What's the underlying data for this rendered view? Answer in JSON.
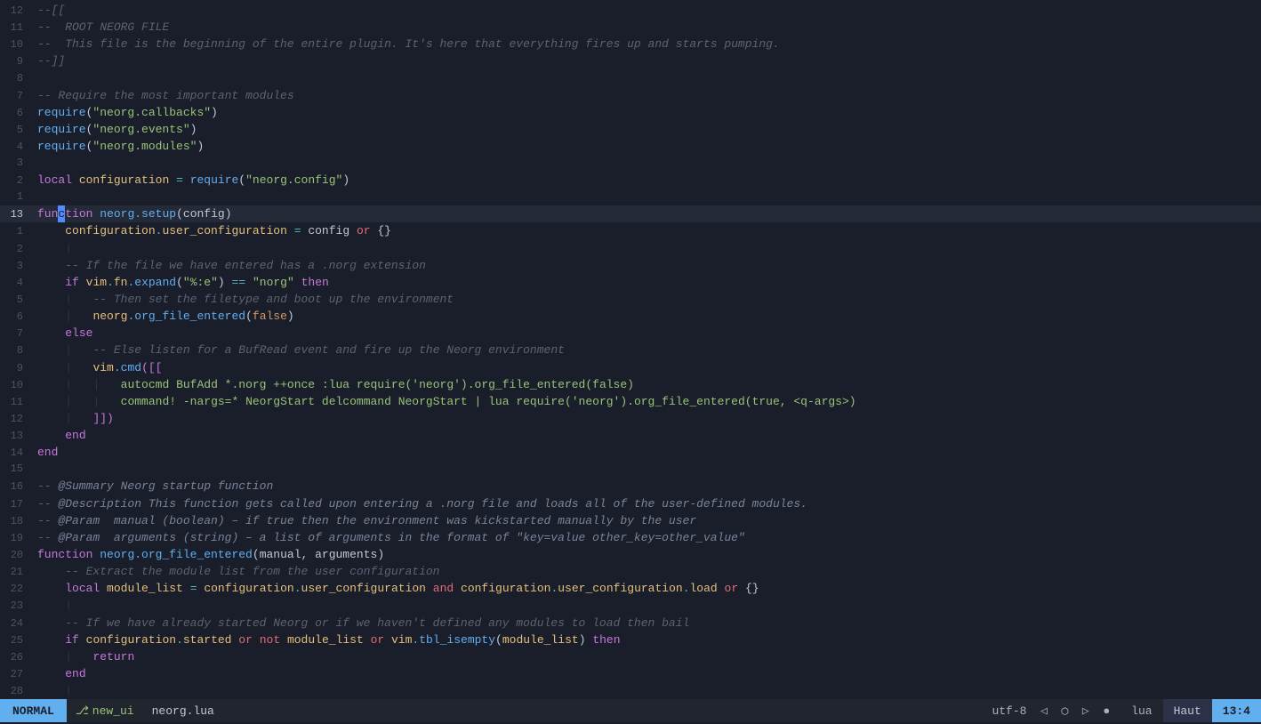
{
  "editor": {
    "lines": [
      {
        "num": "12",
        "content": "--[[",
        "reversed": false
      },
      {
        "num": "11",
        "content": "--  ROOT NEORG FILE",
        "reversed": false
      },
      {
        "num": "10",
        "content": "--  This file is the beginning of the entire plugin. It's here that everything fires up and starts pumping.",
        "reversed": false
      },
      {
        "num": "9",
        "content": "--]]",
        "reversed": false
      },
      {
        "num": "8",
        "content": "",
        "reversed": false
      },
      {
        "num": "7",
        "content": "-- Require the most important modules",
        "reversed": false
      },
      {
        "num": "6",
        "content": "require(\"neorg.callbacks\")",
        "reversed": false
      },
      {
        "num": "5",
        "content": "require(\"neorg.events\")",
        "reversed": false
      },
      {
        "num": "4",
        "content": "require(\"neorg.modules\")",
        "reversed": false
      },
      {
        "num": "3",
        "content": "",
        "reversed": false
      },
      {
        "num": "2",
        "content": "local configuration = require(\"neorg.config\")",
        "reversed": false
      },
      {
        "num": "1",
        "content": "",
        "reversed": false
      },
      {
        "num": "13",
        "content": "function neorg.setup(config)",
        "current": true,
        "reversed": false
      },
      {
        "num": "1",
        "content": "    configuration.user_configuration = config or {}",
        "reversed": false
      },
      {
        "num": "2",
        "content": "    |",
        "reversed": false
      },
      {
        "num": "3",
        "content": "    -- If the file we have entered has a .norg extension",
        "reversed": false
      },
      {
        "num": "4",
        "content": "    if vim.fn.expand(\"%:e\") == \"norg\" then",
        "reversed": false
      },
      {
        "num": "5",
        "content": "    |   -- Then set the filetype and boot up the environment",
        "reversed": false
      },
      {
        "num": "6",
        "content": "    |   neorg.org_file_entered(false)",
        "reversed": false
      },
      {
        "num": "7",
        "content": "    else",
        "reversed": false
      },
      {
        "num": "8",
        "content": "    |   -- Else listen for a BufRead event and fire up the Neorg environment",
        "reversed": false
      },
      {
        "num": "9",
        "content": "    |   vim.cmd([[",
        "reversed": false
      },
      {
        "num": "10",
        "content": "    |   |   autocmd BufAdd *.norg ++once :lua require('neorg').org_file_entered(false)",
        "reversed": false
      },
      {
        "num": "11",
        "content": "    |   |   command! -nargs=* NeorgStart delcommand NeorgStart | lua require('neorg').org_file_entered(true, <q-args>)",
        "reversed": false
      },
      {
        "num": "12",
        "content": "    |   ]])",
        "reversed": false
      },
      {
        "num": "13",
        "content": "    end",
        "reversed": false
      },
      {
        "num": "14",
        "content": "end",
        "reversed": false
      },
      {
        "num": "15",
        "content": "",
        "reversed": false
      },
      {
        "num": "16",
        "content": "-- @Summary Neorg startup function",
        "reversed": false
      },
      {
        "num": "17",
        "content": "-- @Description This function gets called upon entering a .norg file and loads all of the user-defined modules.",
        "reversed": false
      },
      {
        "num": "18",
        "content": "-- @Param  manual (boolean) - if true then the environment was kickstarted manually by the user",
        "reversed": false
      },
      {
        "num": "19",
        "content": "-- @Param  arguments (string) - a list of arguments in the format of \"key=value other_key=other_value\"",
        "reversed": false
      },
      {
        "num": "20",
        "content": "function neorg.org_file_entered(manual, arguments)",
        "reversed": false
      },
      {
        "num": "21",
        "content": "    -- Extract the module list from the user configuration",
        "reversed": false
      },
      {
        "num": "22",
        "content": "    local module_list = configuration.user_configuration and configuration.user_configuration.load or {}",
        "reversed": false
      },
      {
        "num": "23",
        "content": "    |",
        "reversed": false
      },
      {
        "num": "24",
        "content": "    -- If we have already started Neorg or if we haven't defined any modules to load then bail",
        "reversed": false
      },
      {
        "num": "25",
        "content": "    if configuration.started or not module_list or vim.tbl_isempty(module_list) then",
        "reversed": false
      },
      {
        "num": "26",
        "content": "    |   return",
        "reversed": false
      },
      {
        "num": "27",
        "content": "    end",
        "reversed": false
      },
      {
        "num": "28",
        "content": "    |",
        "reversed": false
      }
    ],
    "status": {
      "mode": "NORMAL",
      "branch_icon": "⎇",
      "branch": "new_ui",
      "filename": "neorg.lua",
      "encoding": "utf-8",
      "diff_minus": "◁",
      "diff_circle": "◯",
      "diff_arrow": "▷",
      "diff_dot": "●",
      "filetype": "lua",
      "pos_label": "Haut",
      "pos": "13:4"
    }
  }
}
